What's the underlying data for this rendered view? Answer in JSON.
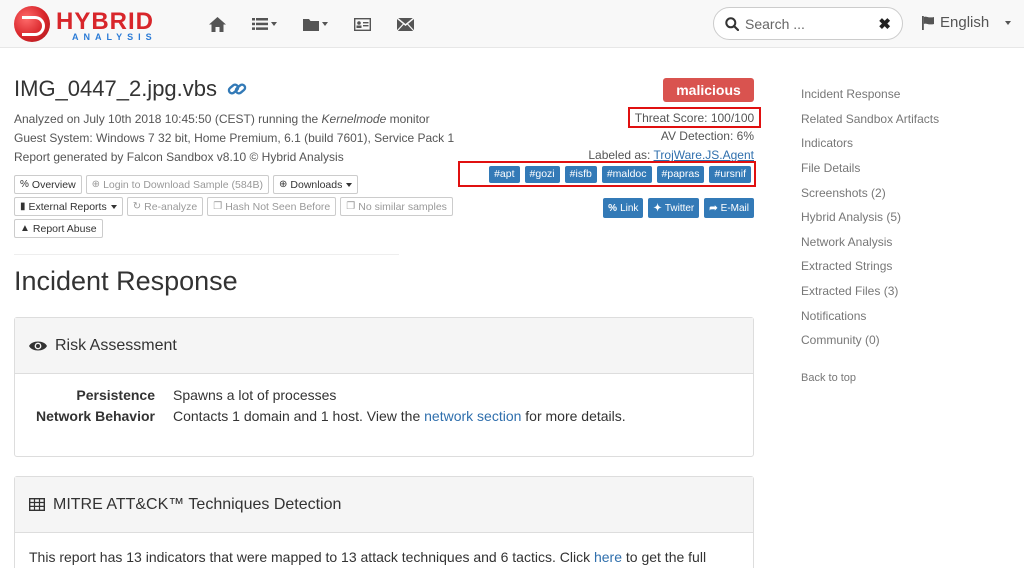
{
  "brand": {
    "word1": "HYBRID",
    "word2": "ANALYSIS",
    "colors": {
      "red": "#d8262b",
      "blue": "#2b7bd6"
    }
  },
  "nav": {
    "icons": [
      "home-icon",
      "list-icon",
      "folder-icon",
      "id-card-icon",
      "envelope-icon"
    ],
    "search_placeholder": "Search ...",
    "search_clear": "✖",
    "language": "English"
  },
  "report": {
    "filename": "IMG_0447_2.jpg.vbs",
    "analyzed_prefix": "Analyzed on July 10th 2018 10:45:50 (CEST) running the ",
    "analyzed_mode": "Kernelmode",
    "analyzed_suffix": " monitor",
    "guest_system": "Guest System: Windows 7 32 bit, Home Premium, 6.1 (build 7601), Service Pack 1",
    "generated_by": "Report generated by Falcon Sandbox v8.10 © Hybrid Analysis",
    "verdict": "malicious",
    "verdict_color": "#d9534f",
    "threat_score": "Threat Score: 100/100",
    "av_detection": "AV Detection: 6%",
    "labeled_as_prefix": "Labeled as: ",
    "labeled_as": "TrojWare.JS.Agent",
    "tags": [
      "#apt",
      "#gozi",
      "#isfb",
      "#maldoc",
      "#papras",
      "#ursnif"
    ],
    "share": {
      "link": "Link",
      "twitter": "Twitter",
      "email": "E-Mail"
    }
  },
  "actions": {
    "overview": "Overview",
    "login_download": "Login to Download Sample (584B)",
    "downloads": "Downloads",
    "external_reports": "External Reports",
    "reanalyze": "Re-analyze",
    "hash_not_seen": "Hash Not Seen Before",
    "no_similar": "No similar samples",
    "report_abuse": "Report Abuse"
  },
  "incident": {
    "title": "Incident Response",
    "risk_panel": {
      "title": "Risk Assessment",
      "rows": [
        {
          "label": "Persistence",
          "value": "Spawns a lot of processes"
        },
        {
          "label": "Network Behavior",
          "value_prefix": "Contacts 1 domain and 1 host. View the ",
          "link": "network section",
          "value_suffix": " for more details."
        }
      ]
    },
    "mitre_panel": {
      "title": "MITRE ATT&CK™ Techniques Detection",
      "text_prefix": "This report has 13 indicators that were mapped to 13 attack techniques and 6 tactics. Click ",
      "link": "here",
      "text_suffix": " to get the full"
    }
  },
  "sidebar": {
    "items": [
      "Incident Response",
      "Related Sandbox Artifacts",
      "Indicators",
      "File Details",
      "Screenshots (2)",
      "Hybrid Analysis (5)",
      "Network Analysis",
      "Extracted Strings",
      "Extracted Files (3)",
      "Notifications",
      "Community (0)"
    ],
    "back_to_top": "Back to top"
  }
}
